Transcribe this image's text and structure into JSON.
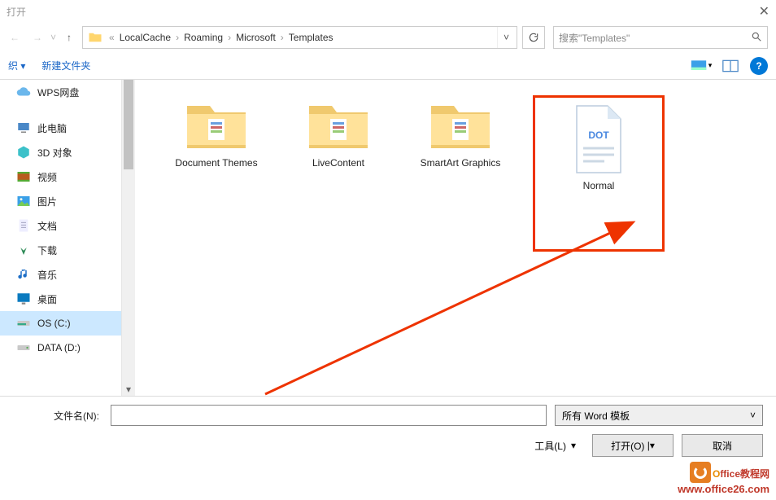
{
  "title": "打开",
  "breadcrumbs": {
    "pre": "«",
    "parts": [
      "LocalCache",
      "Roaming",
      "Microsoft",
      "Templates"
    ]
  },
  "search": {
    "placeholder": "搜索\"Templates\""
  },
  "toolbar": {
    "organize": "织 ▾",
    "newfolder": "新建文件夹"
  },
  "sidebar": {
    "items": [
      {
        "label": "WPS网盘",
        "icon": "cloud"
      },
      {
        "label": "此电脑",
        "icon": "pc"
      },
      {
        "label": "3D 对象",
        "icon": "3d"
      },
      {
        "label": "视频",
        "icon": "video"
      },
      {
        "label": "图片",
        "icon": "pictures"
      },
      {
        "label": "文档",
        "icon": "docs"
      },
      {
        "label": "下载",
        "icon": "download"
      },
      {
        "label": "音乐",
        "icon": "music"
      },
      {
        "label": "桌面",
        "icon": "desktop"
      },
      {
        "label": "OS (C:)",
        "icon": "drive",
        "selected": true
      },
      {
        "label": "DATA (D:)",
        "icon": "drive"
      }
    ]
  },
  "content": {
    "items": [
      {
        "label": "Document Themes",
        "type": "folder"
      },
      {
        "label": "LiveContent",
        "type": "folder"
      },
      {
        "label": "SmartArt Graphics",
        "type": "folder"
      },
      {
        "label": "Normal",
        "type": "dot",
        "highlighted": true
      }
    ]
  },
  "bottom": {
    "fname_label": "文件名(N):",
    "fname_value": "",
    "filter": "所有 Word 模板",
    "tools": "工具(L)",
    "open": "打开(O)",
    "cancel": "取消"
  },
  "watermark": {
    "line1a": "O",
    "line1b": "ffice教程网",
    "line2": "www.office26.com"
  }
}
